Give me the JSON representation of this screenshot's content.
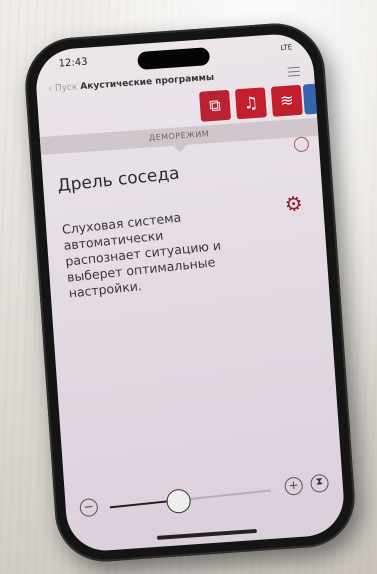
{
  "status": {
    "time": "12:43",
    "network": "LTE"
  },
  "nav": {
    "back_label": "Пуск",
    "title": "Акустические программы"
  },
  "programs": [
    {
      "icon": "speech-program-icon",
      "glyph": "⧉"
    },
    {
      "icon": "music-program-icon",
      "glyph": "♫"
    },
    {
      "icon": "noise-program-icon",
      "glyph": "≋"
    },
    {
      "icon": "extra-program-icon",
      "glyph": ""
    }
  ],
  "demo_mode": "ДЕМОРЕЖИМ",
  "program_title": "Дрель соседа",
  "description": "Слуховая система автоматически распознает ситуацию и выберет оптимальные настройки.",
  "volume": {
    "minus": "−",
    "plus": "+",
    "level": 0.42
  },
  "colors": {
    "brand": "#c21f2d",
    "accent_blue": "#3366aa"
  }
}
